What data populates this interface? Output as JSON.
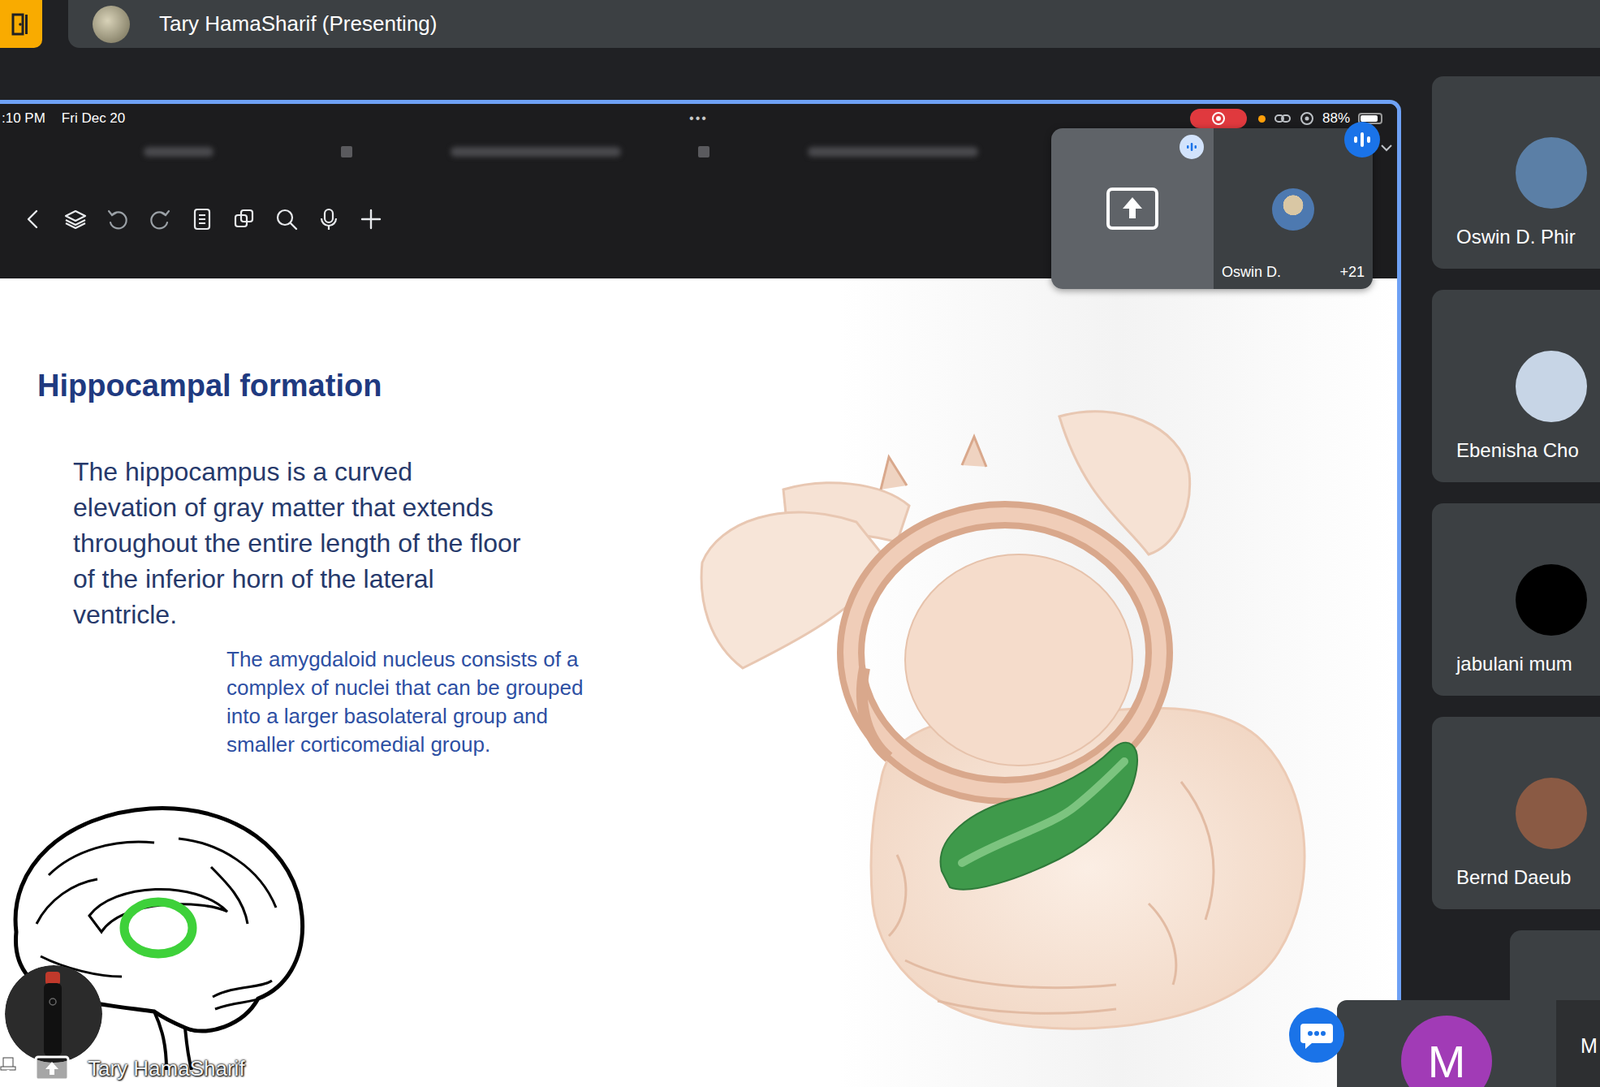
{
  "top_bar": {
    "presenting_label": "Tary HamaSharif (Presenting)"
  },
  "shared_screen": {
    "status_bar": {
      "time": ":10 PM",
      "date": "Fri Dec 20",
      "more": "•••",
      "battery": "88%",
      "battery_level": 0.88
    },
    "mini_panel": {
      "name": "Oswin D.",
      "count": "+21"
    },
    "slide": {
      "title": "Hippocampal formation",
      "body_lines": [
        "The hippocampus is a curved",
        "elevation of gray matter that extends",
        "throughout the entire length of the floor",
        "of the inferior horn of the lateral",
        "ventricle."
      ],
      "note_lines": [
        "The amygdaloid nucleus consists of a",
        "complex of nuclei that can be grouped",
        "into a larger basolateral group and",
        "smaller corticomedial group."
      ]
    },
    "presenter": {
      "name": "Tary HamaSharif"
    }
  },
  "participants": [
    {
      "name": "Oswin D. Phir",
      "color": "#5b7fa6"
    },
    {
      "name": "Ebenisha Cho",
      "color": "#c7d5e6"
    },
    {
      "name": "jabulani mum",
      "color": "#000000"
    },
    {
      "name": "Bernd Daeub",
      "color": "#8a5a44"
    }
  ],
  "bottom_tiles": [
    {
      "label": "M",
      "kind": "avatar",
      "color": "#a13bb6"
    },
    {
      "label": "M",
      "kind": "name"
    }
  ]
}
